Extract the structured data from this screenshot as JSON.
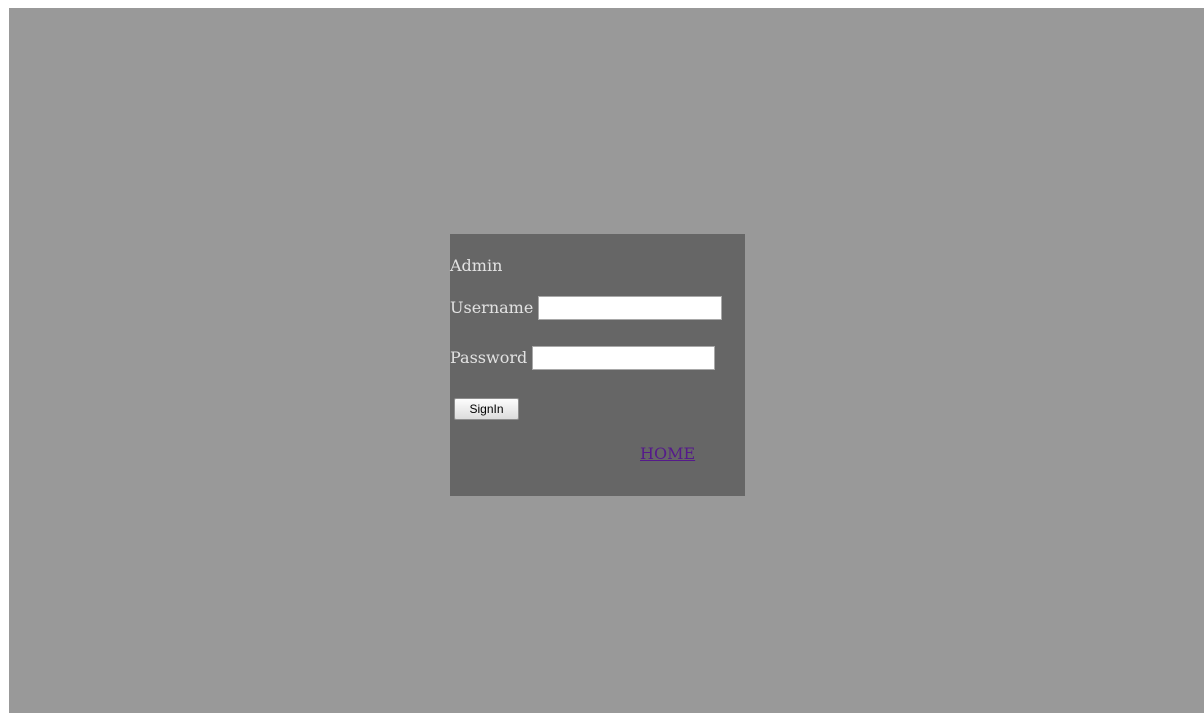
{
  "login": {
    "title": "Admin",
    "username_label": "Username",
    "username_value": "",
    "password_label": "Password",
    "password_value": "",
    "signin_label": "SignIn",
    "home_link": "HOME"
  },
  "colors": {
    "page_background": "#999999",
    "panel_background": "#666666",
    "label_text": "#e2e2e2",
    "visited_link": "#551a8b"
  }
}
